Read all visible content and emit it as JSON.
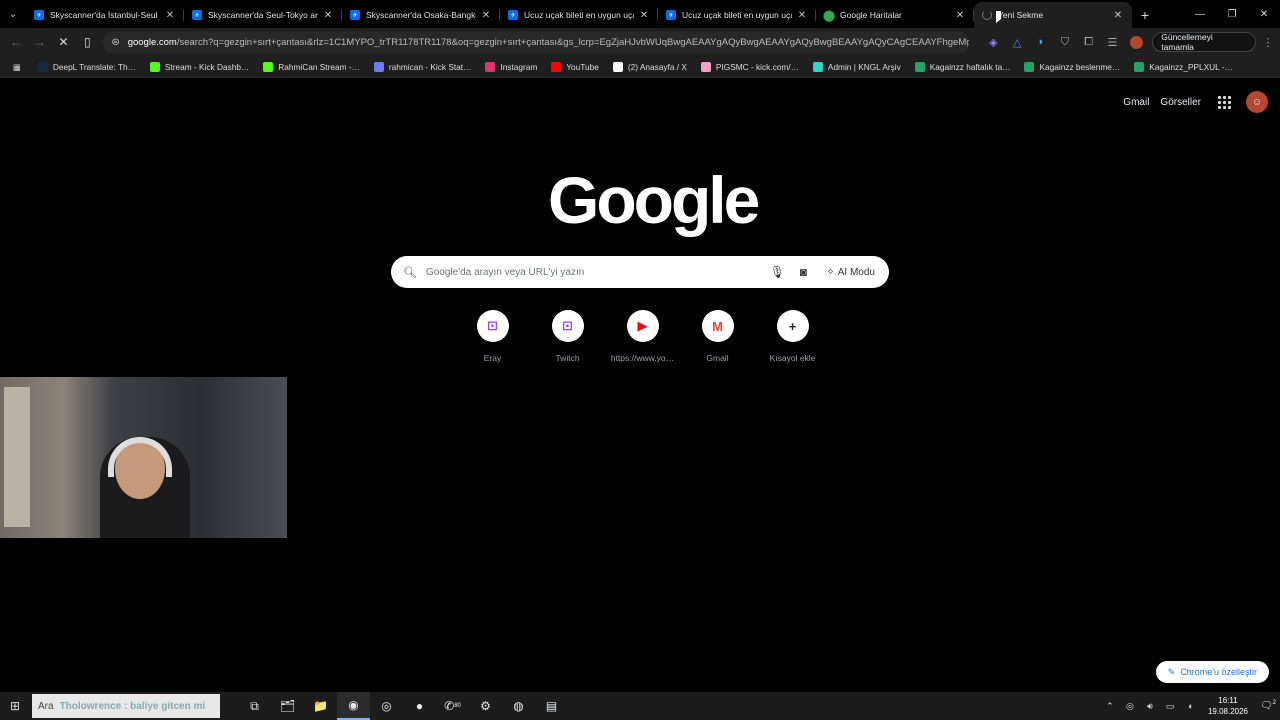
{
  "tabs": [
    {
      "title": "Skyscanner'da İstanbul-Seul ara…",
      "favicon": "skyscanner-icon",
      "active": false
    },
    {
      "title": "Skyscanner'da Seul-Tokyo arası…",
      "favicon": "skyscanner-icon",
      "active": false
    },
    {
      "title": "Skyscanner'da Osaka-Bangkok…",
      "favicon": "skyscanner-icon",
      "active": false
    },
    {
      "title": "Ucuz uçak bileti en uygun uçak…",
      "favicon": "skyscanner-icon",
      "active": false
    },
    {
      "title": "Ucuz uçak bileti en uygun uçak…",
      "favicon": "skyscanner-icon",
      "active": false
    },
    {
      "title": "Google Haritalar",
      "favicon": "maps-pin-icon",
      "active": false
    },
    {
      "title": "Yeni Sekme",
      "favicon": "loading-icon",
      "active": true
    }
  ],
  "toolbar": {
    "url_host": "google.com",
    "url_path": "/search?q=gezgin+sırt+çantası&rlz=1C1MYPO_trTR1178TR1178&oq=gezgin+sırt+çantası&gs_lcrp=EgZjaHJvbWUqBwgAEAAYgAQyBwgAEAAYgAQyBwgBEAAYgAQyCAgCEAAYFhgeMggIAxA…",
    "update_label": "Güncellemeyi tamamla"
  },
  "bookmarks": [
    {
      "label": "DeepL Translate: Th…",
      "icon": "deepl-icon",
      "color": "#0f2b46"
    },
    {
      "label": "Stream - Kick Dashb…",
      "icon": "kick-icon",
      "color": "#53fc18"
    },
    {
      "label": "RahmiCan Stream -…",
      "icon": "kick-icon",
      "color": "#53fc18"
    },
    {
      "label": "rahmican - Kick Stat…",
      "icon": "stats-icon",
      "color": "#6b7cff"
    },
    {
      "label": "Instagram",
      "icon": "instagram-icon",
      "color": "#e1306c"
    },
    {
      "label": "YouTube",
      "icon": "youtube-icon",
      "color": "#ff0000"
    },
    {
      "label": "(2) Anasayfa / X",
      "icon": "x-icon",
      "color": "#ffffff"
    },
    {
      "label": "PIGSMC - kick.com/…",
      "icon": "pig-icon",
      "color": "#ff9ec4"
    },
    {
      "label": "Admin | KNGL Arşiv",
      "icon": "shield-icon",
      "color": "#2bd4c4"
    },
    {
      "label": "Kagainzz haftalık ta…",
      "icon": "sheets-icon",
      "color": "#23a566"
    },
    {
      "label": "Kagainzz  beslenme…",
      "icon": "sheets-icon",
      "color": "#23a566"
    },
    {
      "label": "Kagainzz_PPLXUL -…",
      "icon": "sheets-icon",
      "color": "#23a566"
    }
  ],
  "page": {
    "top_links": {
      "gmail": "Gmail",
      "images": "Görseller"
    },
    "logo": "Google",
    "search_placeholder": "Google'da arayın veya URL'yi yazın",
    "ai_mode": "AI Modu",
    "shortcuts": [
      {
        "label": "Eray",
        "icon": "twitch-icon",
        "glyph": "⊡",
        "color": "#9146ff"
      },
      {
        "label": "Twitch",
        "icon": "twitch-icon",
        "glyph": "⊡",
        "color": "#9146ff"
      },
      {
        "label": "https://www.yo…",
        "icon": "youtube-icon",
        "glyph": "▶",
        "color": "#ff0000"
      },
      {
        "label": "Gmail",
        "icon": "gmail-icon",
        "glyph": "M",
        "color": "#ea4335"
      },
      {
        "label": "Kısayol ekle",
        "icon": "plus-icon",
        "glyph": "+",
        "color": "#202124"
      }
    ],
    "customize_label": "Chrome'u özelleştir"
  },
  "taskbar": {
    "search_text": "Ara",
    "overlay_text": "Tholowrence : baliye gitcen mi",
    "apps": [
      {
        "icon": "task-view-icon",
        "glyph": "⧉"
      },
      {
        "icon": "file-explorer-icon",
        "glyph": "🗂"
      },
      {
        "icon": "folder-icon",
        "glyph": "📁"
      },
      {
        "icon": "chrome-icon",
        "glyph": "◉",
        "active": true
      },
      {
        "icon": "discord-icon",
        "glyph": "◎"
      },
      {
        "icon": "spotify-icon",
        "glyph": "●"
      },
      {
        "icon": "whatsapp-icon",
        "glyph": "✆"
      },
      {
        "icon": "steam-icon",
        "glyph": "⚙"
      },
      {
        "icon": "obs-icon",
        "glyph": "◍"
      },
      {
        "icon": "notepad-icon",
        "glyph": "▤"
      }
    ],
    "whatsapp_badge": "80",
    "time": "16:11",
    "date": "19.08.2026",
    "notifications": "2"
  }
}
